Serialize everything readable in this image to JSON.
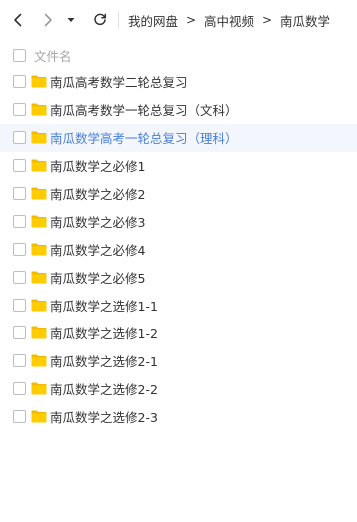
{
  "colors": {
    "accent_text": "#4a7fd9",
    "highlight_row": "#f3f6fc",
    "folder": "#ffcc00",
    "folder_tab": "#f5b800"
  },
  "toolbar": {
    "icons": [
      "chevron-left-icon",
      "chevron-right-icon",
      "caret-down-icon",
      "refresh-icon"
    ]
  },
  "breadcrumb": {
    "items": [
      "我的网盘",
      "高中视频",
      "南瓜数学"
    ],
    "separator": ">"
  },
  "list_header": {
    "column_label": "文件名"
  },
  "files": [
    {
      "name": "南瓜高考数学二轮总复习",
      "selected": false,
      "highlighted": false
    },
    {
      "name": "南瓜高考数学一轮总复习（文科）",
      "selected": false,
      "highlighted": false
    },
    {
      "name": "南瓜数学高考一轮总复习（理科）",
      "selected": false,
      "highlighted": true
    },
    {
      "name": "南瓜数学之必修1",
      "selected": false,
      "highlighted": false
    },
    {
      "name": "南瓜数学之必修2",
      "selected": false,
      "highlighted": false
    },
    {
      "name": "南瓜数学之必修3",
      "selected": false,
      "highlighted": false
    },
    {
      "name": "南瓜数学之必修4",
      "selected": false,
      "highlighted": false
    },
    {
      "name": "南瓜数学之必修5",
      "selected": false,
      "highlighted": false
    },
    {
      "name": "南瓜数学之选修1-1",
      "selected": false,
      "highlighted": false
    },
    {
      "name": "南瓜数学之选修1-2",
      "selected": false,
      "highlighted": false
    },
    {
      "name": "南瓜数学之选修2-1",
      "selected": false,
      "highlighted": false
    },
    {
      "name": "南瓜数学之选修2-2",
      "selected": false,
      "highlighted": false
    },
    {
      "name": "南瓜数学之选修2-3",
      "selected": false,
      "highlighted": false
    }
  ]
}
